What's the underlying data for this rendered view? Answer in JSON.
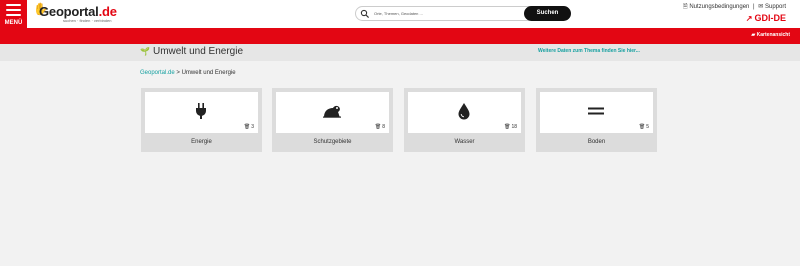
{
  "header": {
    "menu_label": "MENÜ",
    "logo_text": "Geoportal",
    "logo_tld": ".de",
    "logo_tagline": "suchen · finden · verbinden",
    "search_placeholder": "Orte, Themen, Geodaten ...",
    "search_button": "Suchen",
    "terms_link": "Nutzungsbedingungen",
    "support_link": "Support",
    "gdi_link": "GDI-DE"
  },
  "redbar": {
    "map_view": "Kartenansicht"
  },
  "subheader": {
    "title": "Umwelt und Energie",
    "more_data": "Weitere Daten zum Thema finden Sie hier..."
  },
  "breadcrumb": {
    "home": "Geoportal.de",
    "separator": ">",
    "current": "Umwelt und Energie"
  },
  "cards": [
    {
      "label": "Energie",
      "count": "3",
      "icon": "plug-icon"
    },
    {
      "label": "Schutzgebiete",
      "count": "8",
      "icon": "frog-icon"
    },
    {
      "label": "Wasser",
      "count": "18",
      "icon": "water-drop-icon"
    },
    {
      "label": "Boden",
      "count": "5",
      "icon": "equals-icon"
    }
  ],
  "colors": {
    "brand_red": "#e30613",
    "teal": "#15a0a0"
  }
}
